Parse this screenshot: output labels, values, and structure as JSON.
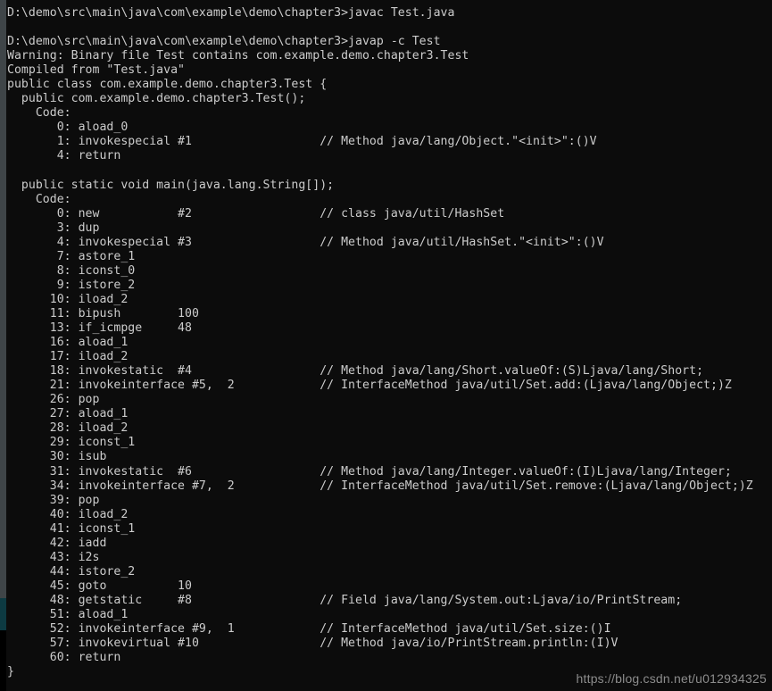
{
  "terminal": {
    "prompt_path": "D:\\demo\\src\\main\\java\\com\\example\\demo\\chapter3>",
    "background_color": "#0c0c0c",
    "text_color": "#cccccc",
    "edge_color": "#3f4548",
    "scroll_thumb_color": "#0d3a42",
    "lines": [
      "D:\\demo\\src\\main\\java\\com\\example\\demo\\chapter3>javac Test.java",
      "",
      "D:\\demo\\src\\main\\java\\com\\example\\demo\\chapter3>javap -c Test",
      "Warning: Binary file Test contains com.example.demo.chapter3.Test",
      "Compiled from \"Test.java\"",
      "public class com.example.demo.chapter3.Test {",
      "  public com.example.demo.chapter3.Test();",
      "    Code:",
      "       0: aload_0",
      "       1: invokespecial #1                  // Method java/lang/Object.\"<init>\":()V",
      "       4: return",
      "",
      "  public static void main(java.lang.String[]);",
      "    Code:",
      "       0: new           #2                  // class java/util/HashSet",
      "       3: dup",
      "       4: invokespecial #3                  // Method java/util/HashSet.\"<init>\":()V",
      "       7: astore_1",
      "       8: iconst_0",
      "       9: istore_2",
      "      10: iload_2",
      "      11: bipush        100",
      "      13: if_icmpge     48",
      "      16: aload_1",
      "      17: iload_2",
      "      18: invokestatic  #4                  // Method java/lang/Short.valueOf:(S)Ljava/lang/Short;",
      "      21: invokeinterface #5,  2            // InterfaceMethod java/util/Set.add:(Ljava/lang/Object;)Z",
      "      26: pop",
      "      27: aload_1",
      "      28: iload_2",
      "      29: iconst_1",
      "      30: isub",
      "      31: invokestatic  #6                  // Method java/lang/Integer.valueOf:(I)Ljava/lang/Integer;",
      "      34: invokeinterface #7,  2            // InterfaceMethod java/util/Set.remove:(Ljava/lang/Object;)Z",
      "      39: pop",
      "      40: iload_2",
      "      41: iconst_1",
      "      42: iadd",
      "      43: i2s",
      "      44: istore_2",
      "      45: goto          10",
      "      48: getstatic     #8                  // Field java/lang/System.out:Ljava/io/PrintStream;",
      "      51: aload_1",
      "      52: invokeinterface #9,  1            // InterfaceMethod java/util/Set.size:()I",
      "      57: invokevirtual #10                 // Method java/io/PrintStream.println:(I)V",
      "      60: return",
      "}"
    ]
  },
  "watermark": {
    "text": "https://blog.csdn.net/u012934325"
  }
}
